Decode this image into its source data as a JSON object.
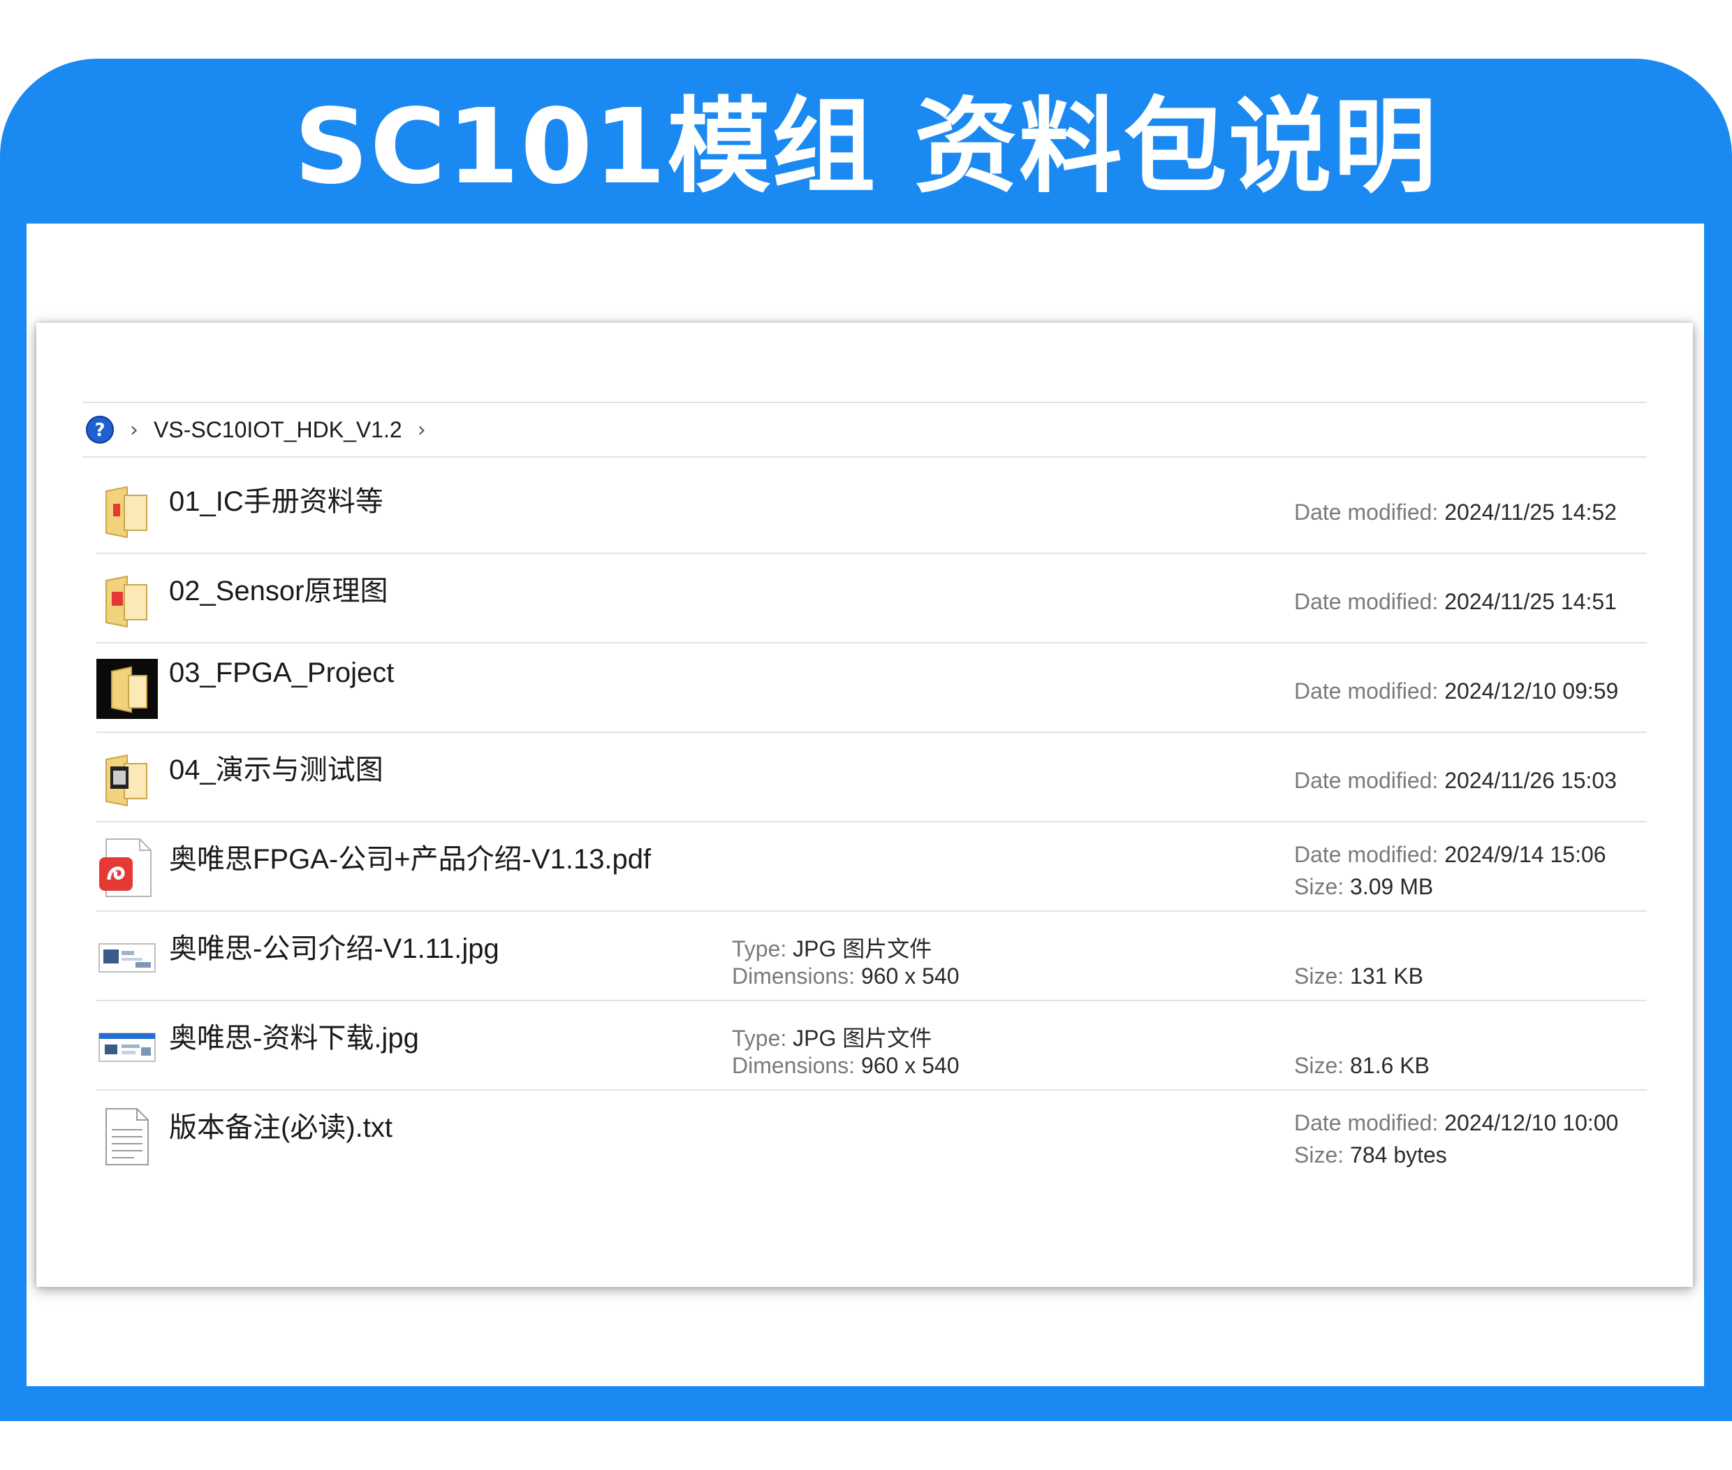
{
  "banner": {
    "title": "SC101模组 资料包说明"
  },
  "address_bar": {
    "icon": "help-icon",
    "crumbs": [
      "VS-SC10IOT_HDK_V1.2"
    ]
  },
  "labels": {
    "date_modified": "Date modified:",
    "size": "Size:",
    "type": "Type:",
    "dimensions": "Dimensions:"
  },
  "files": [
    {
      "name": "01_IC手册资料等",
      "icon": "folder-pdf-icon",
      "date": "2024/11/25 14:52"
    },
    {
      "name": "02_Sensor原理图",
      "icon": "folder-pdf-icon",
      "date": "2024/11/25 14:51"
    },
    {
      "name": "03_FPGA_Project",
      "icon": "folder-dark-icon",
      "date": "2024/12/10 09:59"
    },
    {
      "name": "04_演示与测试图",
      "icon": "folder-image-icon",
      "date": "2024/11/26 15:03"
    },
    {
      "name": "奥唯思FPGA-公司+产品介绍-V1.13.pdf",
      "icon": "pdf-file-icon",
      "date": "2024/9/14 15:06",
      "size": "3.09 MB"
    },
    {
      "name": "奥唯思-公司介绍-V1.11.jpg",
      "icon": "image-file-icon",
      "type": "JPG 图片文件",
      "dimensions": "960 x 540",
      "size": "131 KB"
    },
    {
      "name": "奥唯思-资料下载.jpg",
      "icon": "image-file-icon",
      "type": "JPG 图片文件",
      "dimensions": "960 x 540",
      "size": "81.6 KB"
    },
    {
      "name": "版本备注(必读).txt",
      "icon": "text-file-icon",
      "date": "2024/12/10 10:00",
      "size": "784 bytes"
    }
  ],
  "colors": {
    "banner": "#1a89f2",
    "pdf_red": "#e53935",
    "folder_yellow": "#f2d27a"
  }
}
